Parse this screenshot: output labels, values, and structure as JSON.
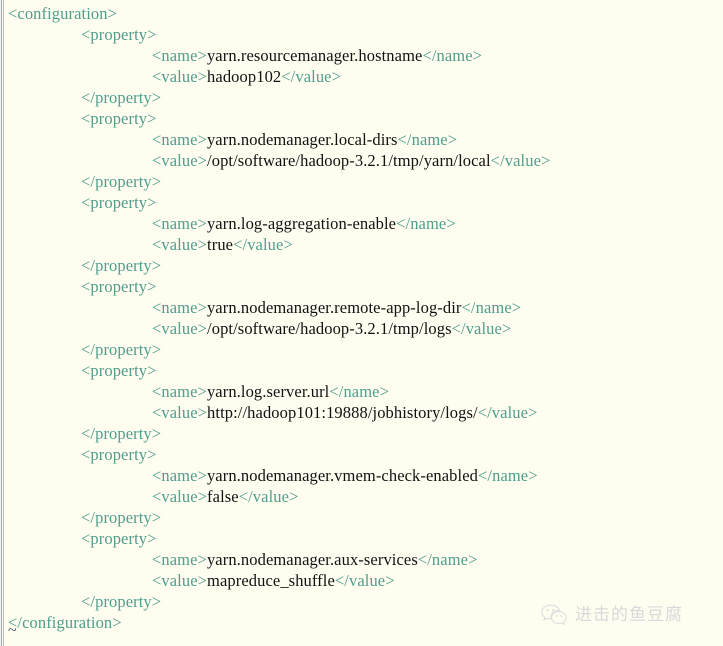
{
  "editor": {
    "background_color": "#fffdf0",
    "tag_color": "#4e9e8d",
    "text_color": "#121212",
    "empty_line_marker": "~"
  },
  "code_lines": [
    {
      "indent": 0,
      "parts": [
        {
          "type": "tag",
          "text": "<configuration>"
        }
      ]
    },
    {
      "indent": 1,
      "parts": [
        {
          "type": "tag",
          "text": "<property>"
        }
      ]
    },
    {
      "indent": 2,
      "parts": [
        {
          "type": "tag",
          "text": "<name>"
        },
        {
          "type": "txt",
          "text": "yarn.resourcemanager.hostname"
        },
        {
          "type": "tag",
          "text": "</name>"
        }
      ]
    },
    {
      "indent": 2,
      "parts": [
        {
          "type": "tag",
          "text": "<value>"
        },
        {
          "type": "txt",
          "text": "hadoop102"
        },
        {
          "type": "tag",
          "text": "</value>"
        }
      ]
    },
    {
      "indent": 1,
      "parts": [
        {
          "type": "tag",
          "text": "</property>"
        }
      ]
    },
    {
      "indent": 1,
      "parts": [
        {
          "type": "tag",
          "text": "<property>"
        }
      ]
    },
    {
      "indent": 2,
      "parts": [
        {
          "type": "tag",
          "text": "<name>"
        },
        {
          "type": "txt",
          "text": "yarn.nodemanager.local-dirs"
        },
        {
          "type": "tag",
          "text": "</name>"
        }
      ]
    },
    {
      "indent": 2,
      "parts": [
        {
          "type": "tag",
          "text": "<value>"
        },
        {
          "type": "txt",
          "text": "/opt/software/hadoop-3.2.1/tmp/yarn/local"
        },
        {
          "type": "tag",
          "text": "</value>"
        }
      ]
    },
    {
      "indent": 1,
      "parts": [
        {
          "type": "tag",
          "text": "</property>"
        }
      ]
    },
    {
      "indent": 1,
      "parts": [
        {
          "type": "tag",
          "text": "<property>"
        }
      ]
    },
    {
      "indent": 2,
      "parts": [
        {
          "type": "tag",
          "text": "<name>"
        },
        {
          "type": "txt",
          "text": "yarn.log-aggregation-enable"
        },
        {
          "type": "tag",
          "text": "</name>"
        }
      ]
    },
    {
      "indent": 2,
      "parts": [
        {
          "type": "tag",
          "text": "<value>"
        },
        {
          "type": "txt",
          "text": "true"
        },
        {
          "type": "tag",
          "text": "</value>"
        }
      ]
    },
    {
      "indent": 1,
      "parts": [
        {
          "type": "tag",
          "text": "</property>"
        }
      ]
    },
    {
      "indent": 1,
      "parts": [
        {
          "type": "tag",
          "text": "<property>"
        }
      ]
    },
    {
      "indent": 2,
      "parts": [
        {
          "type": "tag",
          "text": "<name>"
        },
        {
          "type": "txt",
          "text": "yarn.nodemanager.remote-app-log-dir"
        },
        {
          "type": "tag",
          "text": "</name>"
        }
      ]
    },
    {
      "indent": 2,
      "parts": [
        {
          "type": "tag",
          "text": "<value>"
        },
        {
          "type": "txt",
          "text": "/opt/software/hadoop-3.2.1/tmp/logs"
        },
        {
          "type": "tag",
          "text": "</value>"
        }
      ]
    },
    {
      "indent": 1,
      "parts": [
        {
          "type": "tag",
          "text": "</property>"
        }
      ]
    },
    {
      "indent": 1,
      "parts": [
        {
          "type": "tag",
          "text": "<property>"
        }
      ]
    },
    {
      "indent": 2,
      "parts": [
        {
          "type": "tag",
          "text": "<name>"
        },
        {
          "type": "txt",
          "text": "yarn.log.server.url"
        },
        {
          "type": "tag",
          "text": "</name>"
        }
      ]
    },
    {
      "indent": 2,
      "parts": [
        {
          "type": "tag",
          "text": "<value>"
        },
        {
          "type": "txt",
          "text": "http://hadoop101:19888/jobhistory/logs/"
        },
        {
          "type": "tag",
          "text": "</value>"
        }
      ]
    },
    {
      "indent": 1,
      "parts": [
        {
          "type": "tag",
          "text": "</property>"
        }
      ]
    },
    {
      "indent": 1,
      "parts": [
        {
          "type": "tag",
          "text": "<property>"
        }
      ]
    },
    {
      "indent": 2,
      "parts": [
        {
          "type": "tag",
          "text": "<name>"
        },
        {
          "type": "txt",
          "text": "yarn.nodemanager.vmem-check-enabled"
        },
        {
          "type": "tag",
          "text": "</name>"
        }
      ]
    },
    {
      "indent": 2,
      "parts": [
        {
          "type": "tag",
          "text": "<value>"
        },
        {
          "type": "txt",
          "text": "false"
        },
        {
          "type": "tag",
          "text": "</value>"
        }
      ]
    },
    {
      "indent": 1,
      "parts": [
        {
          "type": "tag",
          "text": "</property>"
        }
      ]
    },
    {
      "indent": 1,
      "parts": [
        {
          "type": "tag",
          "text": "<property>"
        }
      ]
    },
    {
      "indent": 2,
      "parts": [
        {
          "type": "tag",
          "text": "<name>"
        },
        {
          "type": "txt",
          "text": "yarn.nodemanager.aux-services"
        },
        {
          "type": "tag",
          "text": "</name>"
        }
      ]
    },
    {
      "indent": 2,
      "parts": [
        {
          "type": "tag",
          "text": "<value>"
        },
        {
          "type": "txt",
          "text": "mapreduce_shuffle"
        },
        {
          "type": "tag",
          "text": "</value>"
        }
      ]
    },
    {
      "indent": 1,
      "parts": [
        {
          "type": "tag",
          "text": "</property>"
        }
      ]
    },
    {
      "indent": 0,
      "parts": [
        {
          "type": "tag",
          "text": "</configuration>"
        }
      ]
    }
  ],
  "watermark": {
    "icon": "wechat-icon",
    "label": "进击的鱼豆腐",
    "color": "#d9d9d9"
  }
}
